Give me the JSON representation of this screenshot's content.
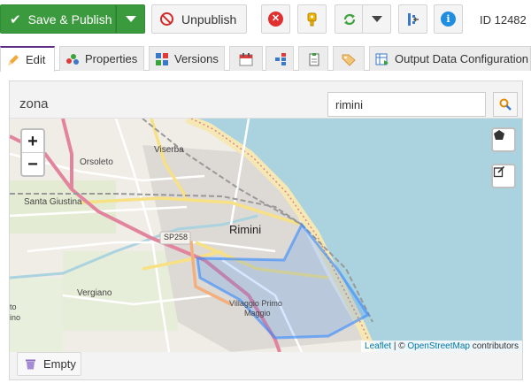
{
  "toolbar": {
    "save_publish_label": "Save & Publish",
    "unpublish_label": "Unpublish",
    "id_text": "ID 12482"
  },
  "tabs": [
    {
      "label": "Edit",
      "icon": "pencil-icon",
      "active": true
    },
    {
      "label": "Properties",
      "icon": "properties-icon"
    },
    {
      "label": "Versions",
      "icon": "versions-icon"
    },
    {
      "label": "",
      "icon": "calendar-icon"
    },
    {
      "label": "",
      "icon": "dependencies-icon"
    },
    {
      "label": "",
      "icon": "notes-icon"
    },
    {
      "label": "",
      "icon": "tag-icon"
    },
    {
      "label": "Output Data Configuration",
      "icon": "output-config-icon"
    }
  ],
  "panel": {
    "title": "zona",
    "search_value": "rimini"
  },
  "map": {
    "zoom_in": "+",
    "zoom_out": "−",
    "labels": {
      "orsoleto": "Orsoleto",
      "viserba": "Viserba",
      "santa_giustina": "Santa Giustina",
      "sp258": "SP258",
      "rimini": "Rimini",
      "vergiano": "Vergiano",
      "villaggio": "Villaggio Primo",
      "maggio": "Maggio",
      "left_edge": "to",
      "left_edge2": "ino"
    },
    "attribution": {
      "leaflet": "Leaflet",
      "sep": " | © ",
      "osm": "OpenStreetMap",
      "tail": " contributors"
    }
  },
  "footer": {
    "empty_label": "Empty"
  },
  "colors": {
    "publish_green": "#3c9a3e",
    "sea": "#aad3df",
    "polygon": "#3388ff",
    "tab_active_border": "#5b2c86"
  }
}
